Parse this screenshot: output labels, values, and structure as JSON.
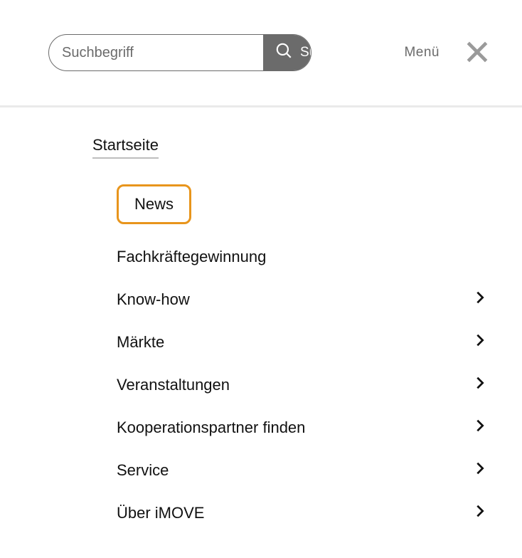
{
  "search": {
    "placeholder": "Suchbegriff",
    "button_label": "Suchen"
  },
  "header": {
    "menu_label": "Menü"
  },
  "nav": {
    "home_label": "Startseite",
    "items": [
      {
        "label": "News",
        "has_children": false,
        "highlighted": true
      },
      {
        "label": "Fachkräftegewinnung",
        "has_children": false,
        "highlighted": false
      },
      {
        "label": "Know-how",
        "has_children": true,
        "highlighted": false
      },
      {
        "label": "Märkte",
        "has_children": true,
        "highlighted": false
      },
      {
        "label": "Veranstaltungen",
        "has_children": true,
        "highlighted": false
      },
      {
        "label": "Kooperationspartner finden",
        "has_children": true,
        "highlighted": false
      },
      {
        "label": "Service",
        "has_children": true,
        "highlighted": false
      },
      {
        "label": "Über iMOVE",
        "has_children": true,
        "highlighted": false
      }
    ]
  }
}
